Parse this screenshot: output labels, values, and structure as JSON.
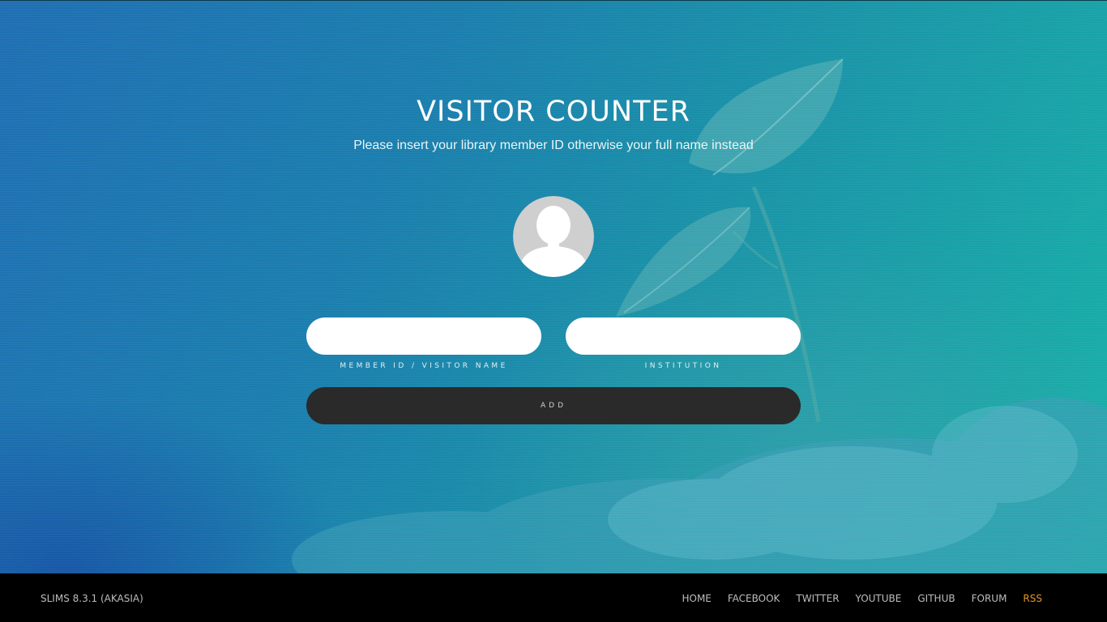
{
  "header": {
    "title": "VISITOR COUNTER",
    "subtitle": "Please insert your library member ID otherwise your full name instead"
  },
  "form": {
    "member_field": {
      "value": "",
      "label": "MEMBER ID / VISITOR NAME"
    },
    "institution_field": {
      "value": "",
      "label": "INSTITUTION"
    },
    "add_label": "ADD"
  },
  "footer": {
    "version": "SLIMS 8.3.1 (AKASIA)",
    "links": [
      {
        "label": "HOME"
      },
      {
        "label": "FACEBOOK"
      },
      {
        "label": "TWITTER"
      },
      {
        "label": "YOUTUBE"
      },
      {
        "label": "GITHUB"
      },
      {
        "label": "FORUM"
      },
      {
        "label": "RSS"
      }
    ]
  },
  "colors": {
    "footer_bg": "#000000",
    "button_bg": "#2a2a2a",
    "rss_accent": "#e0962a"
  },
  "icons": {
    "avatar": "user-silhouette-icon"
  }
}
